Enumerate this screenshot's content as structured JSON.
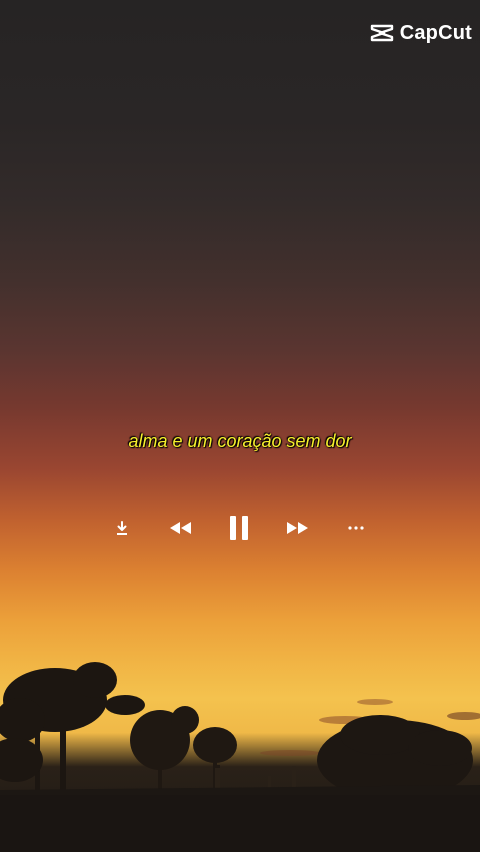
{
  "brand": {
    "name": "CapCut",
    "logo_icon": "capcut-logo-icon"
  },
  "lyric": {
    "text": "alma e um coração sem dor"
  },
  "player": {
    "state": "playing",
    "controls": [
      {
        "name": "download-button",
        "icon": "download-icon"
      },
      {
        "name": "rewind-button",
        "icon": "rewind-icon"
      },
      {
        "name": "pause-button",
        "icon": "pause-icon"
      },
      {
        "name": "fast-forward-button",
        "icon": "fast-forward-icon"
      },
      {
        "name": "more-options-button",
        "icon": "more-horizontal-icon"
      }
    ]
  },
  "colors": {
    "lyric": "#f6ef2c",
    "icons": "#ffffff",
    "sky_top": "#262424",
    "sky_horizon": "#f4c24e"
  }
}
